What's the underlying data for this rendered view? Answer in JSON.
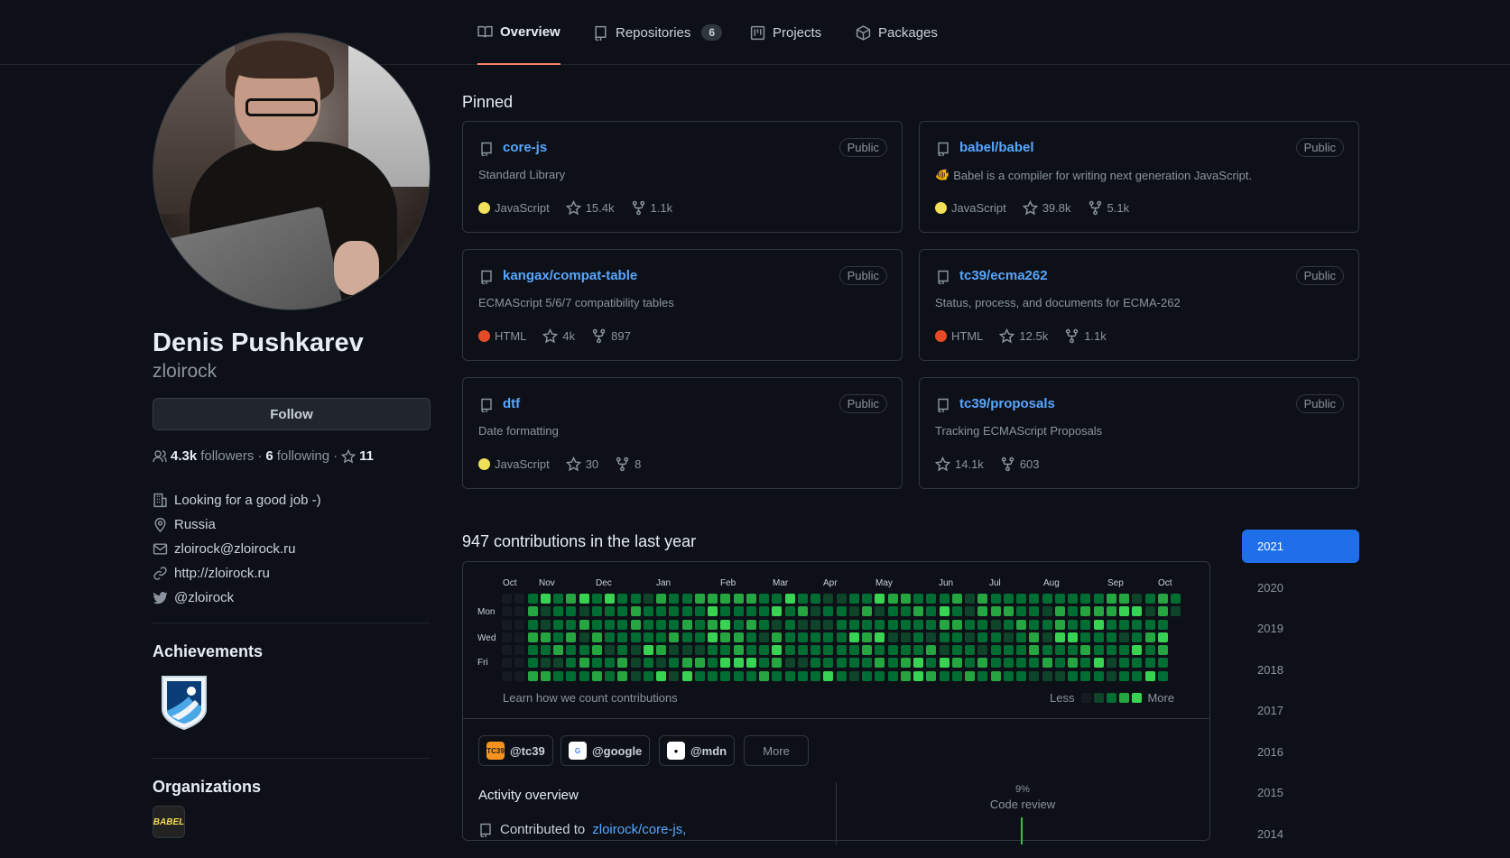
{
  "nav": {
    "tabs": [
      {
        "label": "Overview"
      },
      {
        "label": "Repositories",
        "count": "6"
      },
      {
        "label": "Projects"
      },
      {
        "label": "Packages"
      }
    ]
  },
  "profile": {
    "name": "Denis Pushkarev",
    "login": "zloirock",
    "follow_label": "Follow",
    "followers_count": "4.3k",
    "followers_label": "followers",
    "dot": "·",
    "following_count": "6",
    "following_label": "following",
    "stars_dot": "·",
    "stars_count": "11",
    "company": "Looking for a good job -)",
    "location": "Russia",
    "email": "zloirock@zloirock.ru",
    "website": "http://zloirock.ru",
    "twitter": "@zloirock",
    "achievements_title": "Achievements",
    "organizations_title": "Organizations",
    "org_logo_text": "BABEL"
  },
  "pinned": {
    "title": "Pinned",
    "cards": [
      {
        "repo": "core-js",
        "visibility": "Public",
        "desc": "Standard Library",
        "lang": "JavaScript",
        "lang_color": "#f1e05a",
        "stars": "15.4k",
        "forks": "1.1k"
      },
      {
        "repo": "babel/babel",
        "visibility": "Public",
        "desc": "Babel is a compiler for writing next generation JavaScript.",
        "desc_emoji": "🐠",
        "lang": "JavaScript",
        "lang_color": "#f1e05a",
        "stars": "39.8k",
        "forks": "5.1k"
      },
      {
        "repo": "kangax/compat-table",
        "visibility": "Public",
        "desc": "ECMAScript 5/6/7 compatibility tables",
        "lang": "HTML",
        "lang_color": "#e34c26",
        "stars": "4k",
        "forks": "897"
      },
      {
        "repo": "tc39/ecma262",
        "visibility": "Public",
        "desc": "Status, process, and documents for ECMA-262",
        "lang": "HTML",
        "lang_color": "#e34c26",
        "stars": "12.5k",
        "forks": "1.1k"
      },
      {
        "repo": "dtf",
        "visibility": "Public",
        "desc": "Date formatting",
        "lang": "JavaScript",
        "lang_color": "#f1e05a",
        "stars": "30",
        "forks": "8"
      },
      {
        "repo": "tc39/proposals",
        "visibility": "Public",
        "desc": "Tracking ECMAScript Proposals",
        "lang": "",
        "lang_color": "",
        "stars": "14.1k",
        "forks": "603"
      }
    ]
  },
  "contributions": {
    "title": "947 contributions in the last year",
    "months": [
      "Oct",
      "Nov",
      "Dec",
      "Jan",
      "Feb",
      "Mar",
      "Apr",
      "May",
      "Jun",
      "Jul",
      "Aug",
      "Sep",
      "Oct"
    ],
    "days": [
      "Mon",
      "Wed",
      "Fri"
    ],
    "learn_label": "Learn how we count contributions",
    "less_label": "Less",
    "more_label": "More",
    "level_colors": [
      "#161b22",
      "#0e4429",
      "#006d32",
      "#26a641",
      "#39d353"
    ],
    "orgs": [
      {
        "handle": "@tc39",
        "logo": "TC39",
        "logo_bg": "#f7931e",
        "logo_fg": "#222"
      },
      {
        "handle": "@google",
        "logo": "G",
        "logo_bg": "#ffffff",
        "logo_fg": "#4285f4"
      },
      {
        "handle": "@mdn",
        "logo": "●",
        "logo_bg": "#ffffff",
        "logo_fg": "#000"
      }
    ],
    "more_orgs_label": "More",
    "activity_title": "Activity overview",
    "activity_prefix": "Contributed to",
    "activity_repo": "zloirock/core-js,",
    "code_review_pct": "9%",
    "code_review_label": "Code review"
  },
  "years": [
    "2021",
    "2020",
    "2019",
    "2018",
    "2017",
    "2016",
    "2015",
    "2014"
  ],
  "selected_year": "2021"
}
